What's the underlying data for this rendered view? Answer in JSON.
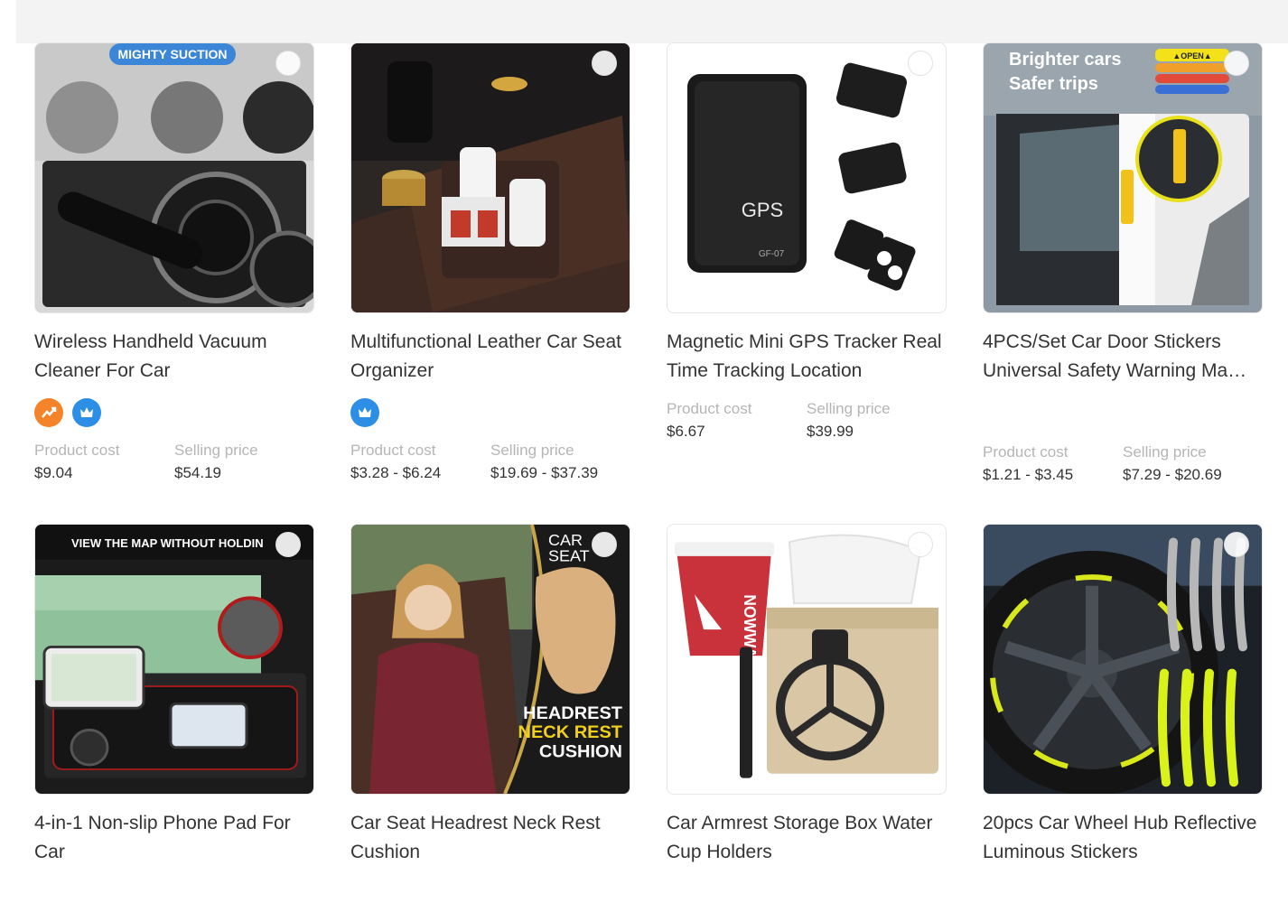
{
  "labels": {
    "cost": "Product cost",
    "selling": "Selling price"
  },
  "products": [
    {
      "title": "Wireless Handheld Vacuum Cleaner For Car",
      "cost": "$9.04",
      "price": "$54.19",
      "image_text": [
        "MIGHTY SUCTION"
      ],
      "badges": [
        "trending-icon",
        "crown-icon"
      ]
    },
    {
      "title": "Multifunctional Leather Car Seat Organizer",
      "cost": "$3.28 - $6.24",
      "price": "$19.69 - $37.39",
      "badges": [
        "crown-icon"
      ]
    },
    {
      "title": "Magnetic Mini GPS Tracker Real Time Tracking Location",
      "cost": "$6.67",
      "price": "$39.99",
      "image_text": [
        "GPS",
        "GF-07"
      ]
    },
    {
      "title": "4PCS/Set Car Door Stickers Universal Safety Warning Ma…",
      "cost": "$1.21 - $3.45",
      "price": "$7.29 - $20.69",
      "image_text": [
        "Brighter cars",
        "Safer trips",
        "▲OPEN▲"
      ]
    },
    {
      "title": "4-in-1 Non-slip Phone Pad For Car",
      "image_text": [
        "VIEW THE MAP WITHOUT HOLDIN"
      ]
    },
    {
      "title": "Car Seat Headrest Neck Rest Cushion",
      "image_text": [
        "CAR",
        "SEAT",
        "HEADREST",
        "NECK REST",
        "CUSHION"
      ]
    },
    {
      "title": "Car Armrest Storage Box Water Cup Holders",
      "image_text": [
        "NOWWA"
      ]
    },
    {
      "title": "20pcs Car Wheel Hub Reflective Luminous Stickers"
    }
  ]
}
